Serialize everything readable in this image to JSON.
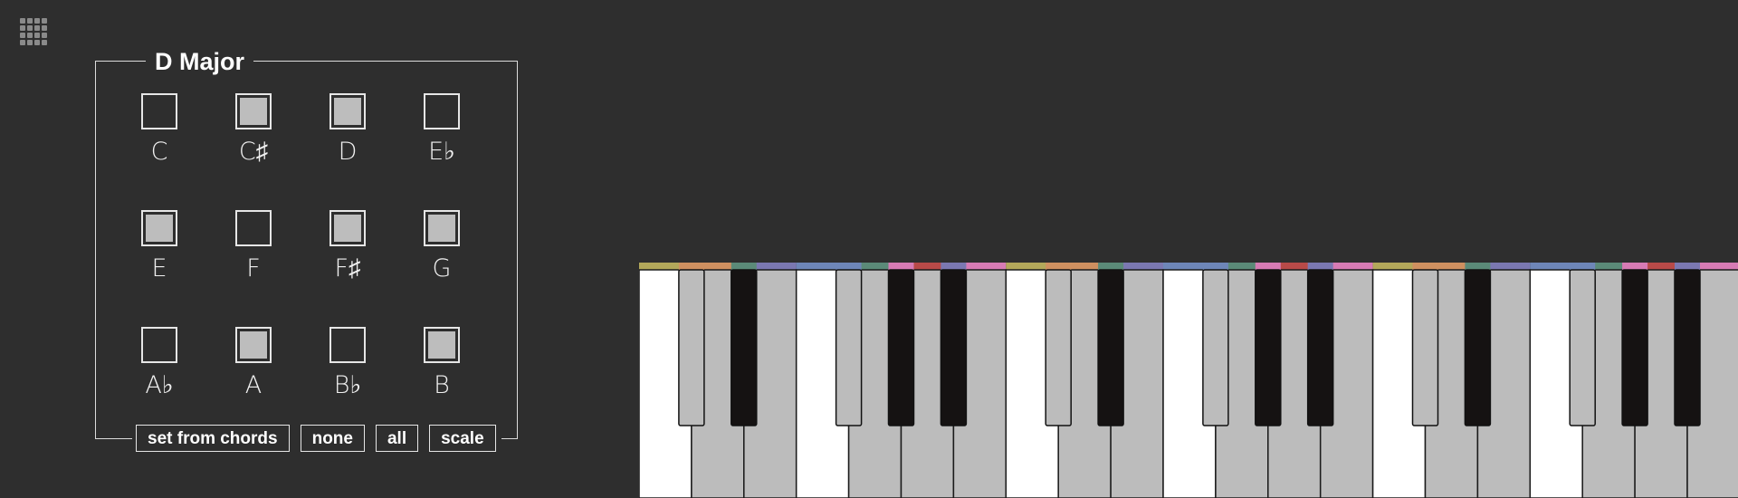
{
  "app": {
    "menu_icon": "grid-menu-icon"
  },
  "scale_panel": {
    "title": "D Major",
    "notes": [
      {
        "label": "C",
        "selected": false
      },
      {
        "label": "C♯",
        "selected": true
      },
      {
        "label": "D",
        "selected": true
      },
      {
        "label": "E♭",
        "selected": false
      },
      {
        "label": "E",
        "selected": true
      },
      {
        "label": "F",
        "selected": false
      },
      {
        "label": "F♯",
        "selected": true
      },
      {
        "label": "G",
        "selected": true
      },
      {
        "label": "A♭",
        "selected": false
      },
      {
        "label": "A",
        "selected": true
      },
      {
        "label": "B♭",
        "selected": false
      },
      {
        "label": "B",
        "selected": true
      }
    ],
    "buttons": {
      "set_from_chords": "set from chords",
      "none": "none",
      "all": "all",
      "scale": "scale"
    }
  },
  "keyboard": {
    "note_colors": [
      "#b3a85a",
      "#cf9060",
      "#7b78b1",
      "#6e86b8",
      "#5b8a78",
      "#b84a48",
      "#d77bb4"
    ],
    "colors": {
      "white_key_in_scale": "#bcbcbc",
      "white_key": "#ffffff",
      "black_key": "#151212",
      "black_key_in_scale": "#bcbcbc"
    }
  }
}
